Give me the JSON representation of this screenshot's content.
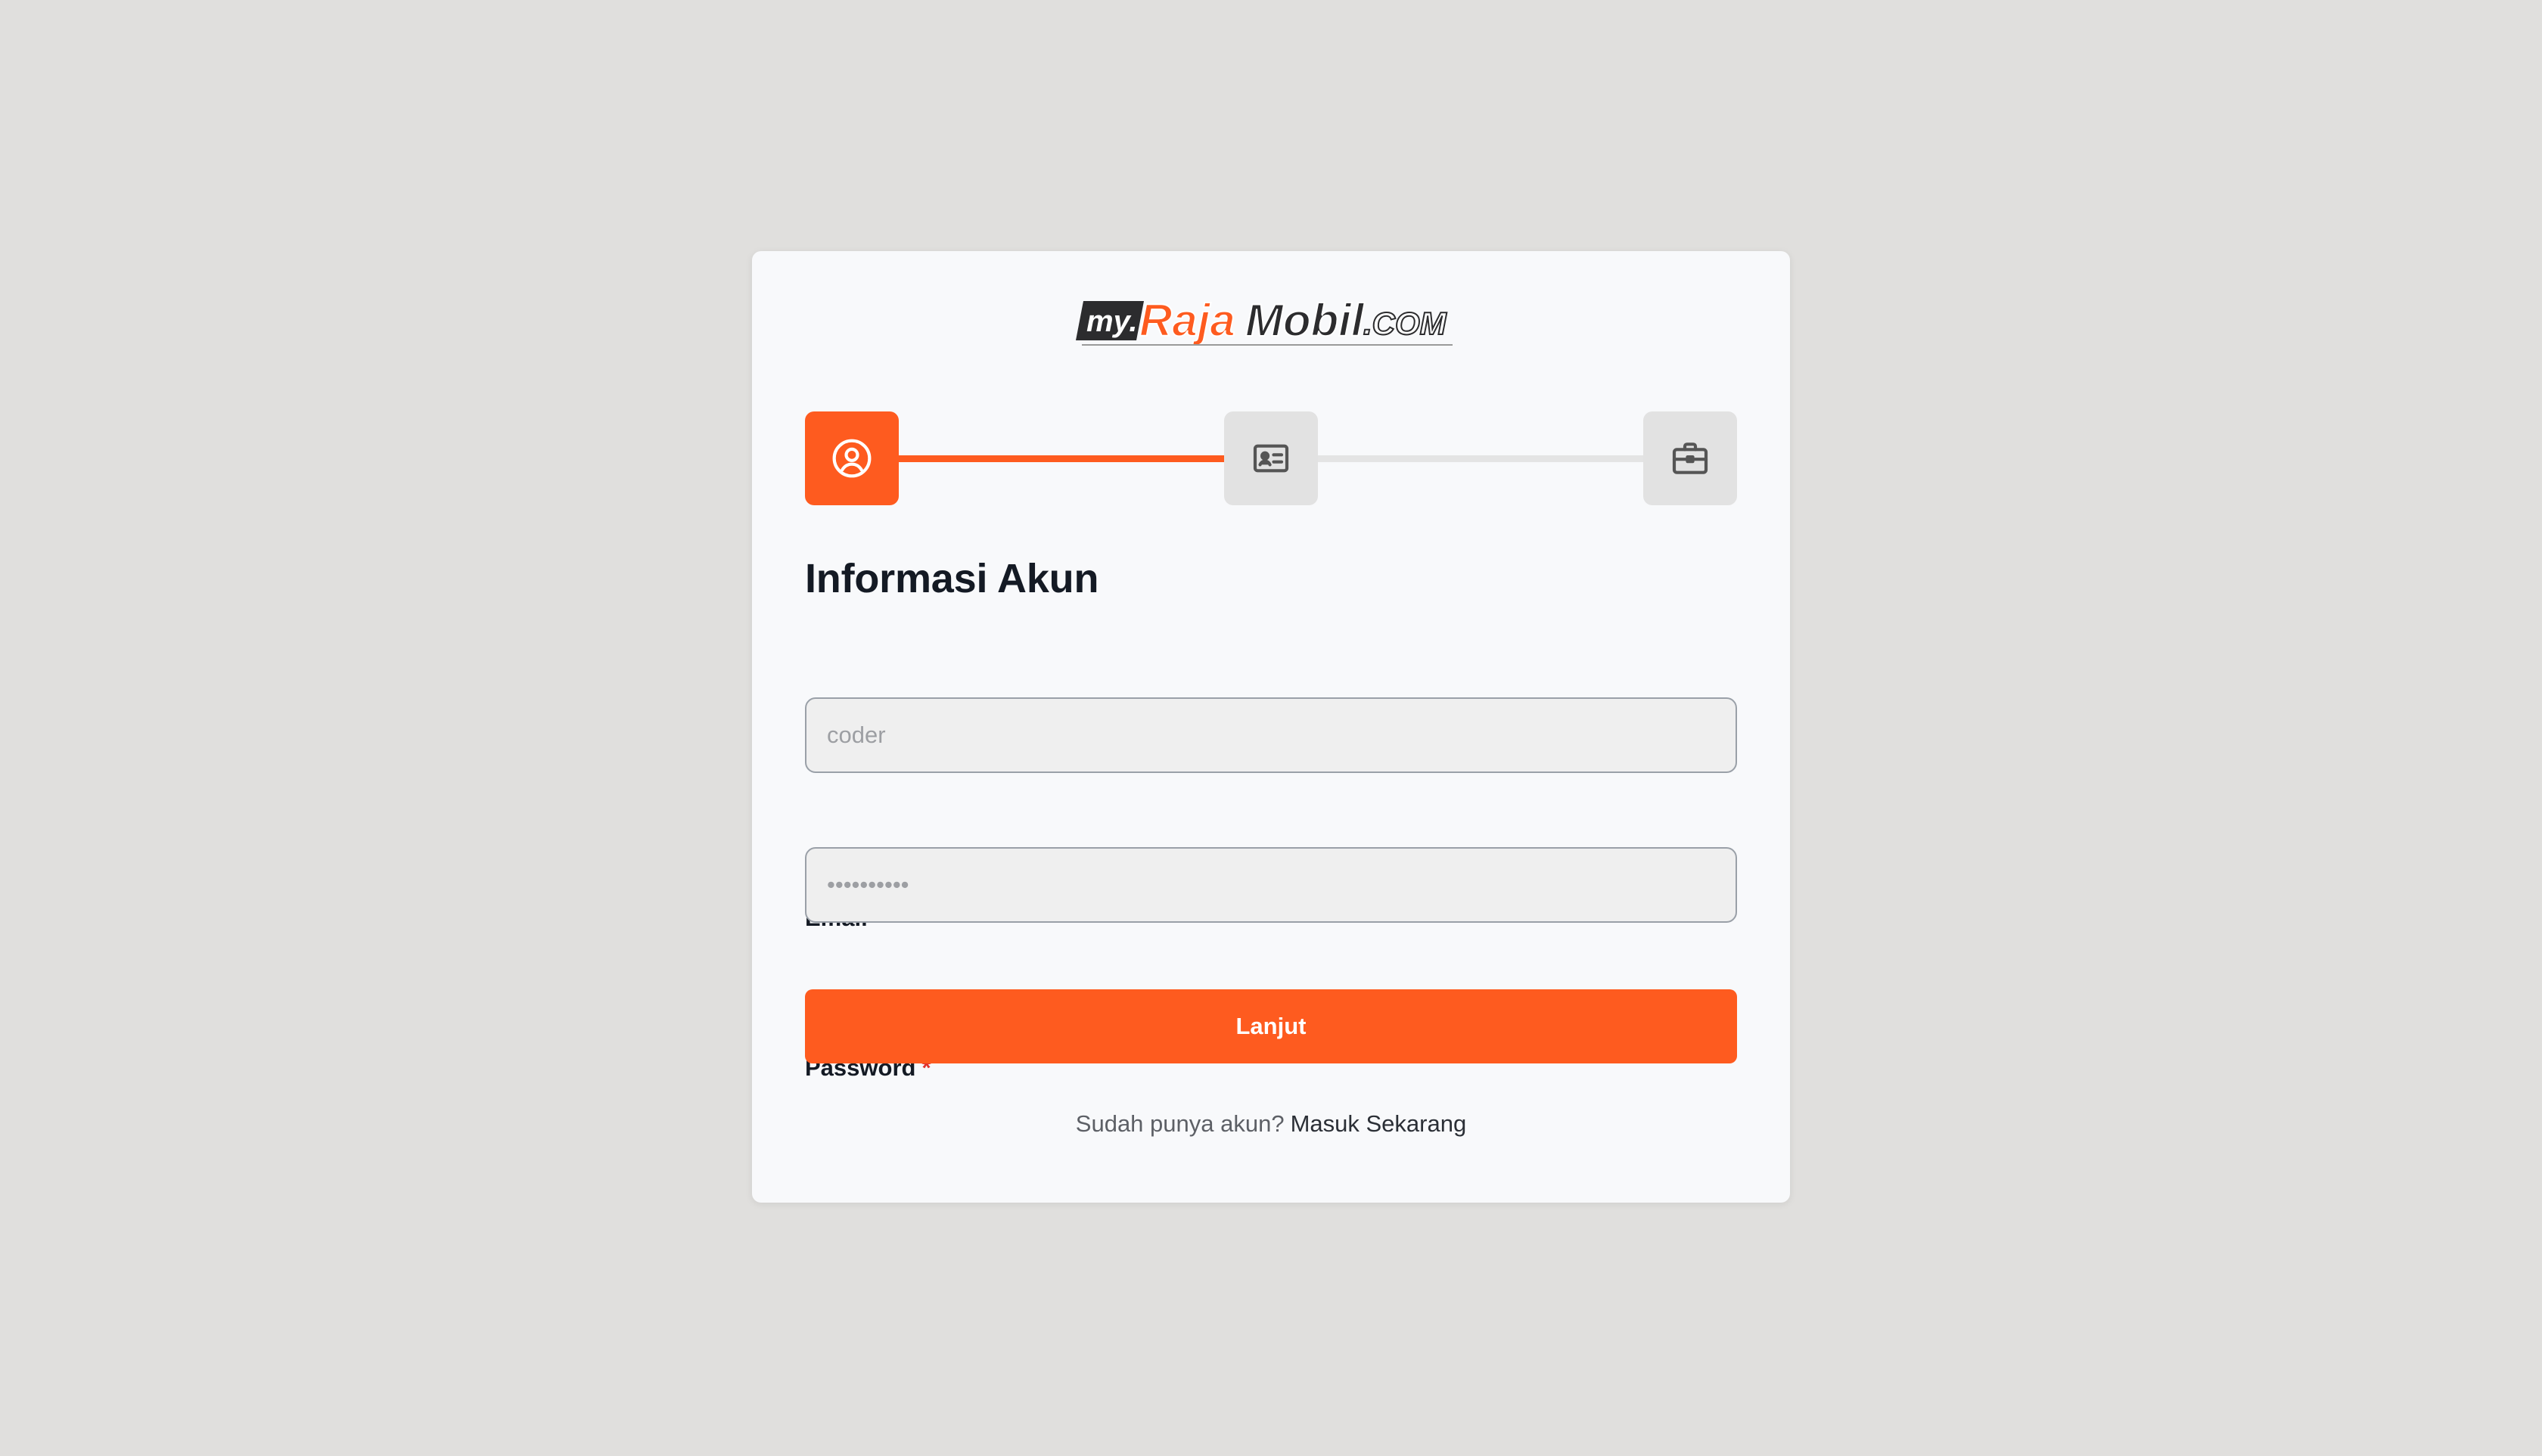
{
  "brand": {
    "logo_text_my": "my.",
    "logo_text_raja": "Raja",
    "logo_text_mobil": "Mobil",
    "logo_text_com": ".COM"
  },
  "stepper": {
    "steps": [
      {
        "icon": "user-circle-icon",
        "state": "active"
      },
      {
        "icon": "id-card-icon",
        "state": "inactive"
      },
      {
        "icon": "briefcase-icon",
        "state": "inactive"
      }
    ],
    "accent_color": "#fe5b1f",
    "inactive_color": "#e2e2e2"
  },
  "form": {
    "title": "Informasi Akun",
    "email_label": "Email",
    "email_value": "coder",
    "password_label": "Password",
    "password_value": "••••••••••",
    "required_marker": "*",
    "submit_label": "Lanjut"
  },
  "footer": {
    "prompt": "Sudah punya akun?",
    "link_text": "Masuk Sekarang"
  }
}
